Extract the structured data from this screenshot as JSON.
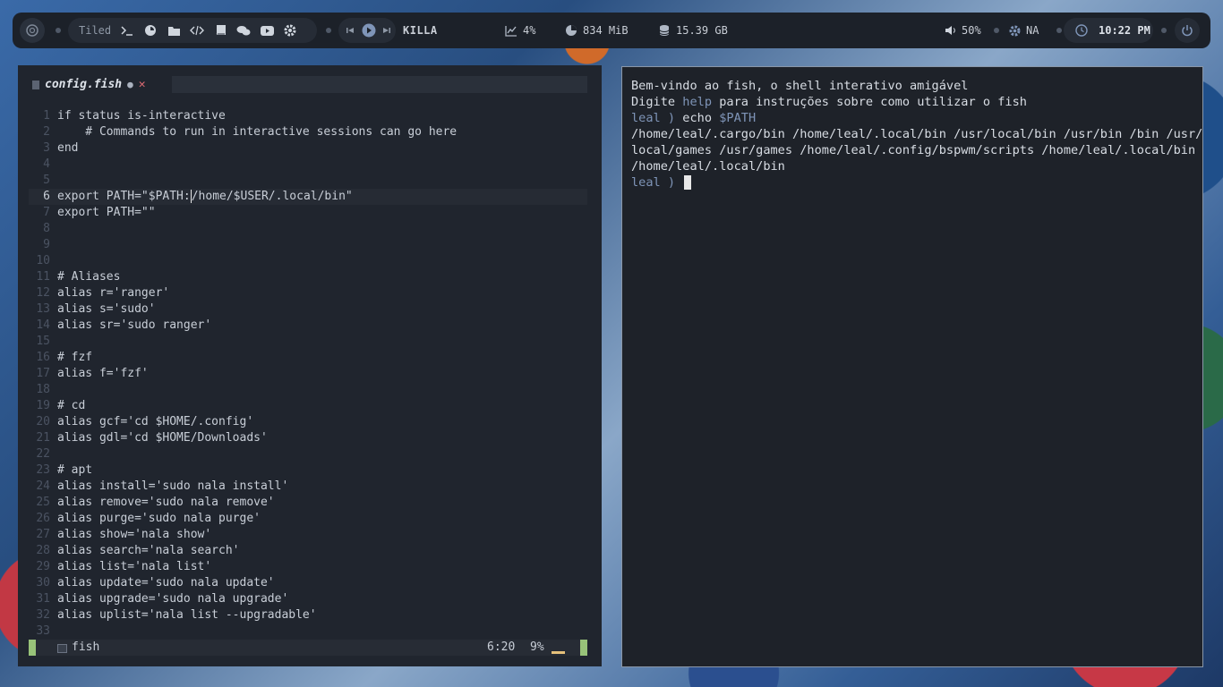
{
  "bar": {
    "layout_label": "Tiled",
    "media_title": "KILLA",
    "cpu": "4%",
    "memory": "834 MiB",
    "disk": "15.39 GB",
    "volume": "50%",
    "network": "NA",
    "time": "10:22 PM",
    "icons": [
      "arch-logo-icon",
      "terminal-icon",
      "firefox-icon",
      "folder-icon",
      "code-icon",
      "book-icon",
      "chat-icon",
      "youtube-icon",
      "settings-icon",
      "prev-icon",
      "play-icon",
      "next-icon",
      "chart-icon",
      "pie-icon",
      "database-icon",
      "volume-icon",
      "network-icon",
      "clock-icon",
      "power-icon"
    ]
  },
  "editor": {
    "tab": {
      "filename": "config.fish",
      "modified_mark": "●",
      "close": "✕"
    },
    "lines": [
      {
        "n": "1",
        "t": "if status is-interactive"
      },
      {
        "n": "2",
        "t": "    # Commands to run in interactive sessions can go here"
      },
      {
        "n": "3",
        "t": "end"
      },
      {
        "n": "4",
        "t": ""
      },
      {
        "n": "5",
        "t": ""
      },
      {
        "n": "6",
        "t": "export PATH=\"$PATH:/home/$USER/.local/bin\""
      },
      {
        "n": "7",
        "t": "export PATH=\"\""
      },
      {
        "n": "8",
        "t": ""
      },
      {
        "n": "9",
        "t": ""
      },
      {
        "n": "10",
        "t": ""
      },
      {
        "n": "11",
        "t": "# Aliases"
      },
      {
        "n": "12",
        "t": "alias r='ranger'"
      },
      {
        "n": "13",
        "t": "alias s='sudo'"
      },
      {
        "n": "14",
        "t": "alias sr='sudo ranger'"
      },
      {
        "n": "15",
        "t": ""
      },
      {
        "n": "16",
        "t": "# fzf"
      },
      {
        "n": "17",
        "t": "alias f='fzf'"
      },
      {
        "n": "18",
        "t": ""
      },
      {
        "n": "19",
        "t": "# cd"
      },
      {
        "n": "20",
        "t": "alias gcf='cd $HOME/.config'"
      },
      {
        "n": "21",
        "t": "alias gdl='cd $HOME/Downloads'"
      },
      {
        "n": "22",
        "t": ""
      },
      {
        "n": "23",
        "t": "# apt"
      },
      {
        "n": "24",
        "t": "alias install='sudo nala install'"
      },
      {
        "n": "25",
        "t": "alias remove='sudo nala remove'"
      },
      {
        "n": "26",
        "t": "alias purge='sudo nala purge'"
      },
      {
        "n": "27",
        "t": "alias show='nala show'"
      },
      {
        "n": "28",
        "t": "alias search='nala search'"
      },
      {
        "n": "29",
        "t": "alias list='nala list'"
      },
      {
        "n": "30",
        "t": "alias update='sudo nala update'"
      },
      {
        "n": "31",
        "t": "alias upgrade='sudo nala upgrade'"
      },
      {
        "n": "32",
        "t": "alias uplist='nala list --upgradable'"
      },
      {
        "n": "33",
        "t": ""
      }
    ],
    "current_line": "6",
    "status": {
      "filetype": "fish",
      "position": "6:20",
      "percent": "9%"
    }
  },
  "terminal": {
    "welcome": "Bem-vindo ao fish, o shell interativo amigável",
    "help_pre": "Digite ",
    "help_word": "help",
    "help_post": " para instruções sobre como utilizar o fish",
    "prompt": "leal ) ",
    "cmd_pre": "echo ",
    "cmd_var": "$PATH",
    "output": [
      "/home/leal/.cargo/bin /home/leal/.local/bin /usr/local/bin /usr/bin /bin /usr/",
      "local/games /usr/games /home/leal/.config/bspwm/scripts /home/leal/.local/bin",
      "/home/leal/.local/bin"
    ],
    "prompt2": "leal ) "
  },
  "colors": {
    "accent_green": "#98c379",
    "close_red": "#e06c75",
    "prompt_blue": "#7f95b8",
    "progress_yellow": "#e5c07b"
  }
}
